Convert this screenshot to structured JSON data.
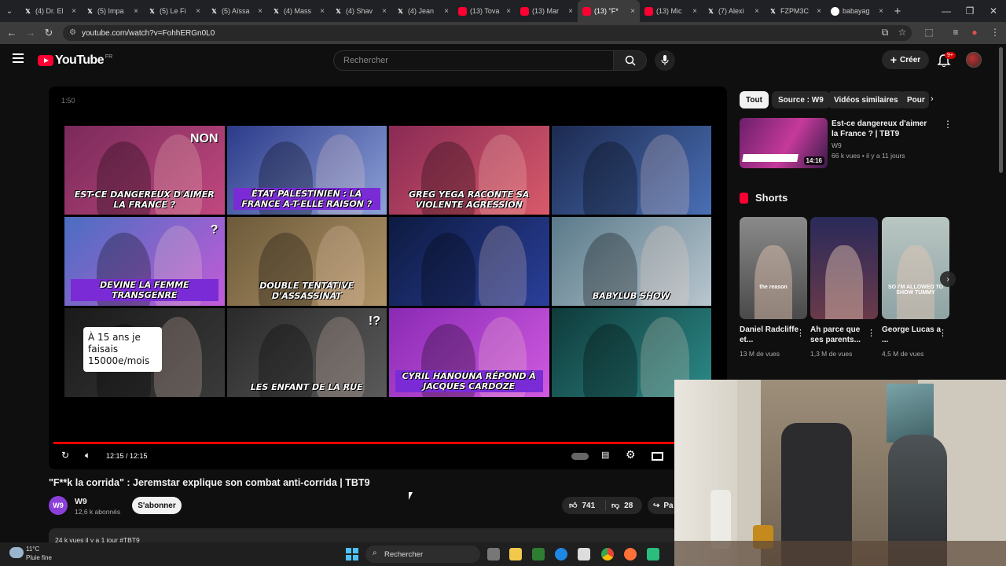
{
  "browser": {
    "tabs": [
      {
        "label": "(4) Dr. El",
        "fav": "X"
      },
      {
        "label": "(5) Impa",
        "fav": "X"
      },
      {
        "label": "(5) Le Fi",
        "fav": "X"
      },
      {
        "label": "(5) Aïssa",
        "fav": "X"
      },
      {
        "label": "(4) Mass",
        "fav": "X"
      },
      {
        "label": "(4) Shav",
        "fav": "X"
      },
      {
        "label": "(4) Jean",
        "fav": "X"
      },
      {
        "label": "(13) Tova",
        "fav": "YT"
      },
      {
        "label": "(13) Mar",
        "fav": "YT"
      },
      {
        "label": "(13) \"F*",
        "fav": "YT",
        "active": true
      },
      {
        "label": "(13) Mic",
        "fav": "YT"
      },
      {
        "label": "(7) Alexi",
        "fav": "X"
      },
      {
        "label": "FZPM3C",
        "fav": "X"
      },
      {
        "label": "babayag",
        "fav": "G"
      }
    ],
    "close_glyph": "×",
    "new_tab_glyph": "+",
    "url": "youtube.com/watch?v=FohhERGn0L0",
    "window_controls": {
      "minimize": "—",
      "maximize": "❐",
      "close": "✕"
    }
  },
  "youtube": {
    "logo_text": "YouTube",
    "country_code": "FR",
    "search_placeholder": "Rechercher",
    "create_label": "Créer",
    "notif_badge": "9+"
  },
  "player": {
    "top_time": "1:50",
    "current_time": "12:15 / 12:15",
    "progress_fraction": 1.0,
    "endscreen": [
      {
        "caption": "EST-CE DANGEREUX D'AIMER LA FRANCE ?",
        "badge": "NON",
        "bg": [
          "#7a2a5a",
          "#c0487f"
        ]
      },
      {
        "caption": "ÉTAT PALESTINIEN : LA FRANCE A-T-ELLE RAISON ?",
        "badge": "",
        "bg": [
          "#2b3b8a",
          "#8ea0d8"
        ]
      },
      {
        "caption": "GREG YEGA RACONTE SA VIOLENTE AGRESSION",
        "badge": "",
        "bg": [
          "#8a2a55",
          "#d85a6a"
        ]
      },
      {
        "caption": "",
        "badge": "",
        "bg": [
          "#1c2a50",
          "#4a6fb5"
        ]
      },
      {
        "caption": "DEVINE LA FEMME TRANSGENRE",
        "badge": "?",
        "bg": [
          "#4a6ec0",
          "#c35bd8"
        ]
      },
      {
        "caption": "DOUBLE TENTATIVE D'ASSASSINAT",
        "badge": "",
        "bg": [
          "#6d5a3a",
          "#b09468"
        ]
      },
      {
        "caption": "",
        "badge": "",
        "bg": [
          "#0d1a40",
          "#2a3f9a"
        ]
      },
      {
        "caption": "BABYLUB SHOW",
        "badge": "",
        "bg": [
          "#5a7a8a",
          "#b8c6cf"
        ]
      },
      {
        "caption": "À 15 ans je faisais 15000e/mois",
        "badge": "",
        "bg": [
          "#1a1a1a",
          "#3a3a3a"
        ]
      },
      {
        "caption": "LES ENFANT DE LA RUE",
        "badge": "!?",
        "bg": [
          "#2a2a2a",
          "#5a5a5a"
        ]
      },
      {
        "caption": "CYRIL HANOUNA RÉPOND À JACQUES CARDOZE",
        "badge": "",
        "bg": [
          "#8a2ab5",
          "#d05ae0"
        ]
      },
      {
        "caption": "",
        "badge": "",
        "bg": [
          "#0f3a3a",
          "#2c8a88"
        ]
      }
    ]
  },
  "video": {
    "title": "\"F**k la corrida\" : Jeremstar explique son combat anti-corrida | TBT9",
    "channel": "W9",
    "channel_avatar_text": "W9",
    "subscribers": "12,6 k abonnés",
    "subscribe_label": "S'abonner",
    "likes": "741",
    "dislikes": "28",
    "share_label": "Pa",
    "description_preview": "24 k vues  il y a 1 jour  #TBT9"
  },
  "sidebar": {
    "chips": [
      "Tout",
      "Source : W9",
      "Vidéos similaires",
      "Pour"
    ],
    "recommendation": {
      "title": "Est-ce dangereux d'aimer la France ? | TBT9",
      "channel": "W9",
      "meta": "66 k vues • il y a 11 jours",
      "duration": "14:16"
    },
    "shorts_label": "Shorts",
    "shorts": [
      {
        "title": "Daniel Radcliffe et...",
        "views": "13 M de vues",
        "caption": "the reason"
      },
      {
        "title": "Ah parce que ses parents...",
        "views": "1,3 M de vues",
        "caption": ""
      },
      {
        "title": "George Lucas a ...",
        "views": "4,5 M de vues",
        "caption": "SO I'M ALLOWED TO SHOW TUMMY"
      }
    ]
  },
  "taskbar": {
    "temperature": "11°C",
    "condition": "Pluie fine",
    "search_label": "Rechercher"
  },
  "colors": {
    "accent": "#ff0033",
    "progress": "#ff0000",
    "background": "#0f0f0f"
  }
}
